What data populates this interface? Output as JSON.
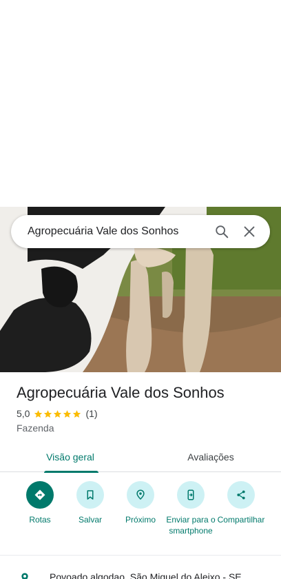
{
  "search": {
    "query": "Agropecuária Vale dos Sonhos"
  },
  "place": {
    "name": "Agropecuária Vale dos Sonhos",
    "rating": "5,0",
    "stars": 5,
    "review_count": "(1)",
    "category": "Fazenda"
  },
  "tabs": [
    {
      "label": "Visão geral",
      "active": true
    },
    {
      "label": "Avaliações",
      "active": false
    }
  ],
  "actions": [
    {
      "label": "Rotas",
      "icon": "directions-icon"
    },
    {
      "label": "Salvar",
      "icon": "bookmark-icon"
    },
    {
      "label": "Próximo",
      "icon": "nearby-icon"
    },
    {
      "label": "Enviar para o smartphone",
      "icon": "send-to-phone-icon"
    },
    {
      "label": "Compartilhar",
      "icon": "share-icon"
    }
  ],
  "address": {
    "text": "Povoado algodao, São Miguel do Aleixo - SE"
  },
  "colors": {
    "accent": "#00796b",
    "action_bg": "#cdf1f4",
    "star": "#fbbc04"
  }
}
